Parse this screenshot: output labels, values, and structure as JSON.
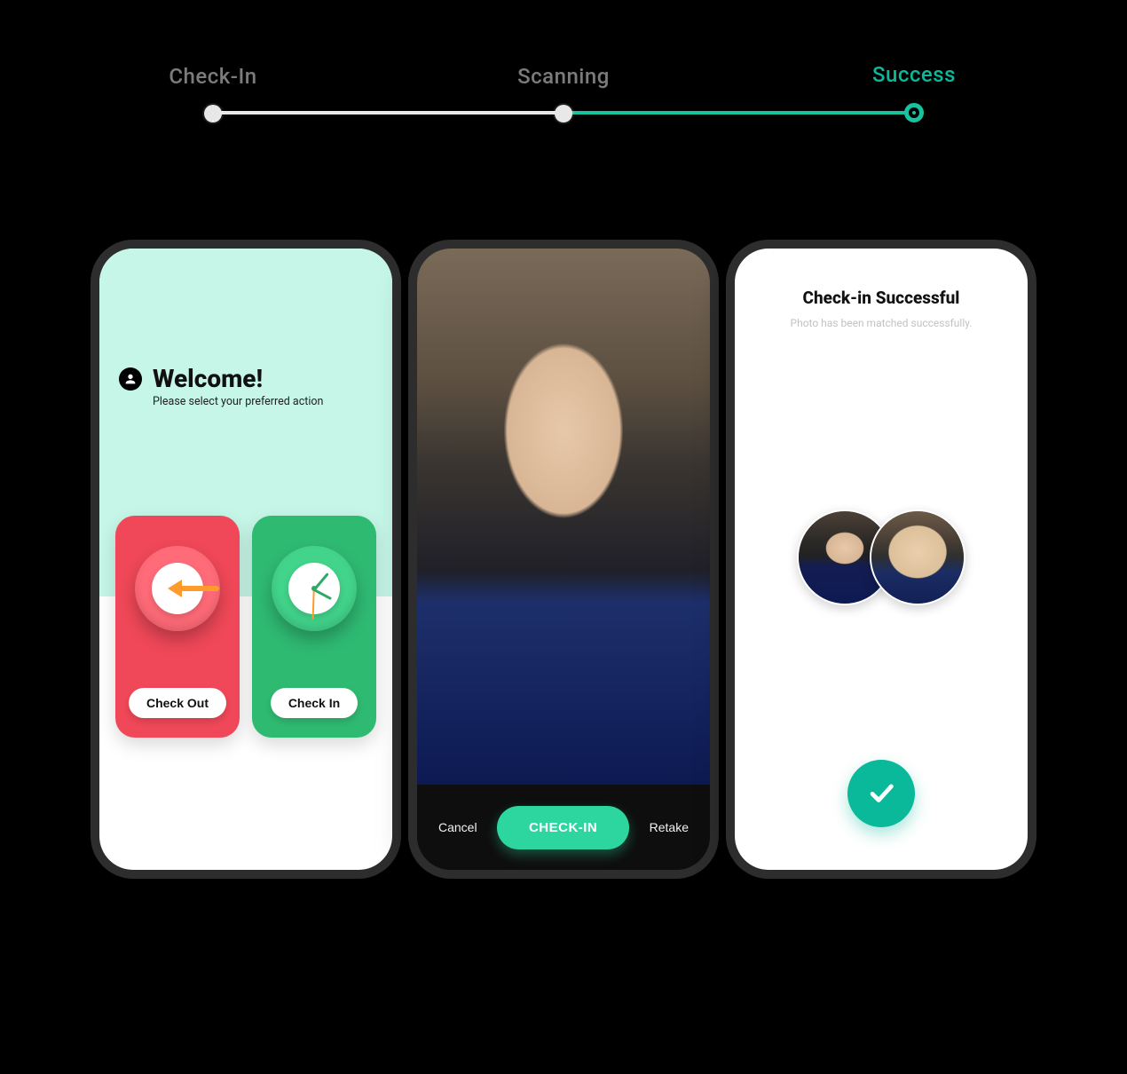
{
  "colors": {
    "teal": "#0ab89a",
    "mint": "#c6f6e8",
    "red_card": "#f04858",
    "green_card": "#2fba72"
  },
  "stepper": {
    "steps": [
      {
        "label": "Check-In",
        "state": "done"
      },
      {
        "label": "Scanning",
        "state": "done"
      },
      {
        "label": "Success",
        "state": "active"
      }
    ]
  },
  "screen1": {
    "title": "Welcome!",
    "subtitle": "Please select your preferred action",
    "checkout_label": "Check Out",
    "checkin_label": "Check In"
  },
  "screen2": {
    "cancel_label": "Cancel",
    "confirm_label": "CHECK-IN",
    "retake_label": "Retake"
  },
  "screen3": {
    "title": "Check-in Successful",
    "subtitle": "Photo has been matched successfully."
  }
}
